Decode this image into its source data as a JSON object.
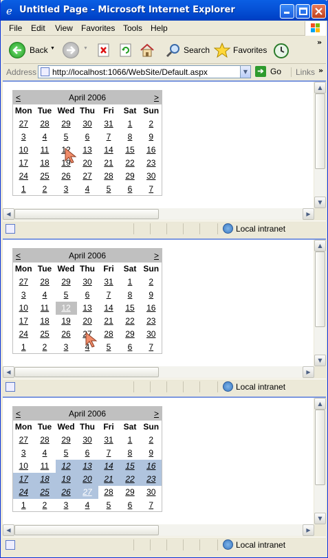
{
  "window": {
    "title": "Untitled Page - Microsoft Internet Explorer"
  },
  "menu": [
    "File",
    "Edit",
    "View",
    "Favorites",
    "Tools",
    "Help"
  ],
  "toolbar": {
    "back": "Back",
    "search": "Search",
    "favorites": "Favorites"
  },
  "address": {
    "label": "Address",
    "url": "http://localhost:1066/WebSite/Default.aspx",
    "go": "Go",
    "links": "Links"
  },
  "status": {
    "zone": "Local intranet"
  },
  "calendar": {
    "prev": "<",
    "next": ">",
    "month": "April 2006",
    "days": [
      "Mon",
      "Tue",
      "Wed",
      "Thu",
      "Fri",
      "Sat",
      "Sun"
    ],
    "weeks": [
      [
        "27",
        "28",
        "29",
        "30",
        "31",
        "1",
        "2"
      ],
      [
        "3",
        "4",
        "5",
        "6",
        "7",
        "8",
        "9"
      ],
      [
        "10",
        "11",
        "12",
        "13",
        "14",
        "15",
        "16"
      ],
      [
        "17",
        "18",
        "19",
        "20",
        "21",
        "22",
        "23"
      ],
      [
        "24",
        "25",
        "26",
        "27",
        "28",
        "29",
        "30"
      ],
      [
        "1",
        "2",
        "3",
        "4",
        "5",
        "6",
        "7"
      ]
    ]
  },
  "panels": [
    {
      "name": "unselected"
    },
    {
      "name": "day-selected",
      "selected_day": "12"
    },
    {
      "name": "range-selected",
      "range_start": "12",
      "range_end": "27"
    }
  ],
  "colors": {
    "title_bg": "#c0c0c0",
    "selected_bg": "#c0c0c0",
    "range_bg": "#b0c4de",
    "titlebar": "#0a5fe4"
  }
}
